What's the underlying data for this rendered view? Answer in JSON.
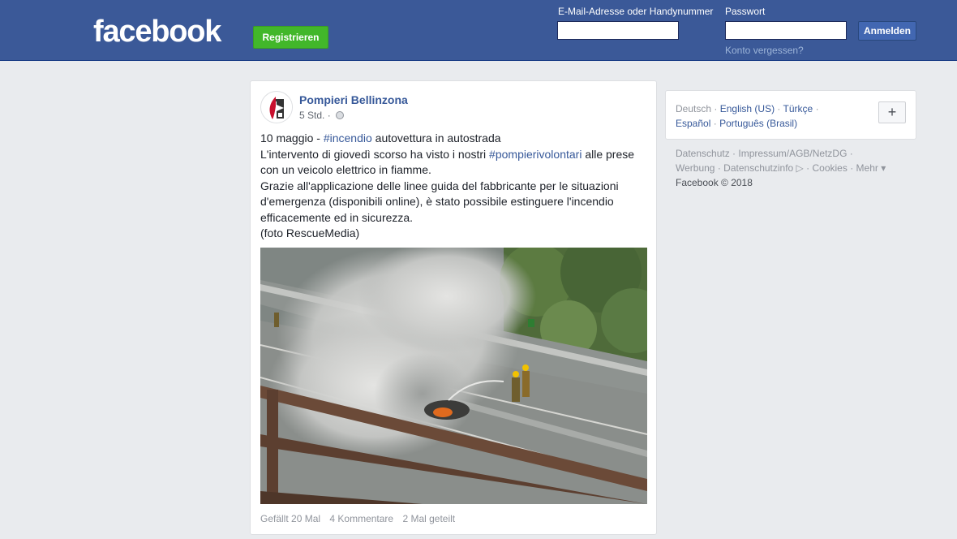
{
  "header": {
    "logo": "facebook",
    "register_label": "Registrieren",
    "email_label": "E-Mail-Adresse oder Handynummer",
    "email_value": "",
    "password_label": "Passwort",
    "password_value": "",
    "login_label": "Anmelden",
    "forgot_label": "Konto vergessen?"
  },
  "post": {
    "page_name": "Pompieri Bellinzona",
    "time": "5 Std. ·",
    "text": {
      "l1_pre": "10 maggio - ",
      "l1_tag": "#incendio",
      "l1_post": " autovettura in autostrada",
      "l2_pre": "L'intervento di giovedì scorso ha visto i nostri ",
      "l2_tag": "#pompierivolontari",
      "l2_post": " alle prese",
      "l3": "con un veicolo elettrico in fiamme.",
      "l4": "Grazie all'applicazione delle linee guida del fabbricante per le situazioni",
      "l5": "d'emergenza (disponibili online), è stato possibile estinguere l'incendio",
      "l6": "efficacemente ed in sicurezza.",
      "l7": "(foto RescueMedia)"
    },
    "stats": {
      "likes": "Gefällt 20 Mal",
      "comments": "4 Kommentare",
      "shares": "2 Mal geteilt"
    }
  },
  "languages": {
    "current": "Deutsch",
    "items": [
      "English (US)",
      "Türkçe",
      "Español",
      "Português (Brasil)"
    ],
    "more_label": "+"
  },
  "footer": {
    "links": [
      "Datenschutz",
      "Impressum/AGB/NetzDG",
      "Werbung",
      "Datenschutzinfo ▷",
      "Cookies",
      "Mehr ▾"
    ],
    "copyright": "Facebook © 2018"
  },
  "colors": {
    "brand_blue": "#3b5998",
    "register_green": "#42b72a",
    "link_blue": "#365899",
    "background": "#e9ebee"
  }
}
